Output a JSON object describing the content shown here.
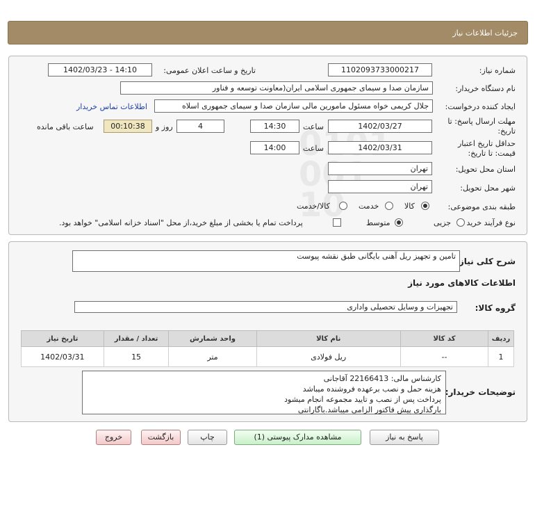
{
  "header": {
    "title": "جزئیات اطلاعات نیاز"
  },
  "need_info": {
    "need_number_label": "شماره نیاز:",
    "need_number": "1102093733000217",
    "announce_label": "تاریخ و ساعت اعلان عمومی:",
    "announce_value": "1402/03/23 - 14:10",
    "buyer_org_label": "نام دستگاه خریدار:",
    "buyer_org": "سازمان صدا و سیمای جمهوری اسلامی ایران(معاونت توسعه و فناور",
    "creator_label": "ایجاد کننده درخواست:",
    "creator": "جلال کریمی خواه مسئول مامورین مالی  سازمان صدا و سیمای جمهوری اسلاه",
    "contact_link": "اطلاعات تماس خریدار",
    "deadline_label_1": "مهلت ارسال پاسخ: تا",
    "deadline_label_2": "تاریخ:",
    "deadline_date": "1402/03/27",
    "time_label": "ساعت",
    "deadline_time": "14:30",
    "days_value": "4",
    "days_label": "روز و",
    "remaining_time": "00:10:38",
    "remaining_label": "ساعت باقی مانده",
    "validity_label_1": "حداقل تاریخ اعتبار",
    "validity_label_2": "قیمت: تا تاریخ:",
    "validity_date": "1402/03/31",
    "validity_time": "14:00",
    "province_label": "استان محل تحویل:",
    "province": "تهران",
    "city_label": "شهر محل تحویل:",
    "city": "تهران",
    "category_label": "طبقه بندی موضوعی:",
    "category_options": [
      "کالا",
      "خدمت",
      "کالا/خدمت"
    ],
    "category_selected": "کالا",
    "process_label": "نوع فرآیند خرید :",
    "process_options": [
      "جزیی",
      "متوسط"
    ],
    "process_selected": "متوسط",
    "payment_note": "پرداخت تمام یا بخشی از مبلغ خرید،از محل \"اسناد خزانه اسلامی\" خواهد بود."
  },
  "description": {
    "label": "شرح کلی نیاز:",
    "value": "تامین و تجهیز ریل آهنی بایگانی طبق نقشه پیوست"
  },
  "goods": {
    "section_title": "اطلاعات کالاهای مورد نیاز",
    "group_label": "گروه کالا:",
    "group_value": "تجهیزات و وسایل تحصیلی واداری",
    "columns": [
      "ردیف",
      "کد کالا",
      "نام کالا",
      "واحد شمارش",
      "تعداد / مقدار",
      "تاریخ نیاز"
    ],
    "rows": [
      [
        "1",
        "--",
        "ریل فولادی",
        "متر",
        "15",
        "1402/03/31"
      ]
    ]
  },
  "buyer_notes": {
    "label": "توضیحات خریدار:",
    "lines": [
      "کارشناس مالی: 22166413 آقاجانی",
      "هزینه حمل و نصب برعهده فروشنده میباشد",
      "پرداخت پس از نصب و تایید مجموعه انجام میشود",
      "بارگذاری پیش فاکتور الزامی میباشد.باگارانتی"
    ]
  },
  "buttons": {
    "reply": "پاسخ به نیاز",
    "attachments": "مشاهده مدارک پیوستی (1)",
    "print": "چاپ",
    "back": "بازگشت",
    "exit": "خروج"
  },
  "watermark": {
    "brand": "ParsNamadData",
    "line1": "پایگاه اطلاع رسانی مناقصات",
    "line2": "۰۲۱-۸۸۳۴۹۶۷۰-۵",
    "persian": "پارس نماد داده ها"
  },
  "colors": {
    "header_bg": "#a38b67",
    "link": "#1d3fa8",
    "remaining_bg": "#f0e6c0"
  }
}
